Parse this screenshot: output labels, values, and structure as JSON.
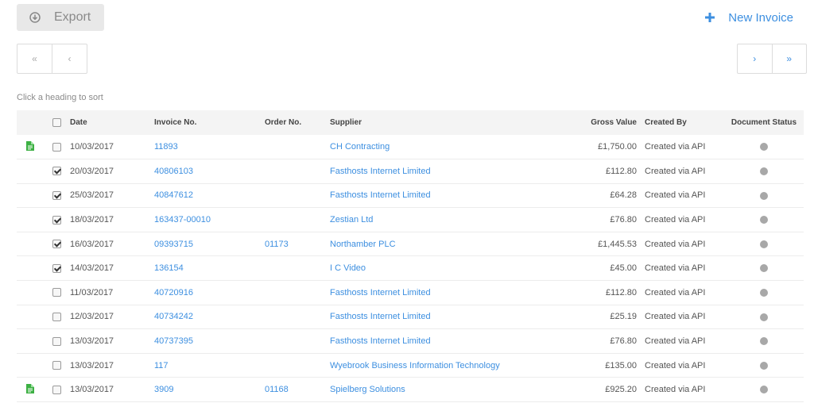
{
  "toolbar": {
    "export_label": "Export",
    "new_invoice_label": "New Invoice"
  },
  "pager": {
    "first": "«",
    "prev": "‹",
    "next": "›",
    "last": "»"
  },
  "sort_hint": "Click a heading to sort",
  "columns": {
    "date": "Date",
    "invoice_no": "Invoice No.",
    "order_no": "Order No.",
    "supplier": "Supplier",
    "gross_value": "Gross Value",
    "created_by": "Created By",
    "document_status": "Document Status"
  },
  "colors": {
    "accent": "#3d8fe0",
    "doc_icon": "#3cb043",
    "status_dot": "#a8a8a8"
  },
  "rows": [
    {
      "has_doc": true,
      "checked": false,
      "date": "10/03/2017",
      "invoice_no": "11893",
      "order_no": "",
      "supplier": "CH Contracting",
      "gross_value": "£1,750.00",
      "created_by": "Created via API"
    },
    {
      "has_doc": false,
      "checked": true,
      "date": "20/03/2017",
      "invoice_no": "40806103",
      "order_no": "",
      "supplier": "Fasthosts Internet Limited",
      "gross_value": "£112.80",
      "created_by": "Created via API"
    },
    {
      "has_doc": false,
      "checked": true,
      "date": "25/03/2017",
      "invoice_no": "40847612",
      "order_no": "",
      "supplier": "Fasthosts Internet Limited",
      "gross_value": "£64.28",
      "created_by": "Created via API"
    },
    {
      "has_doc": false,
      "checked": true,
      "date": "18/03/2017",
      "invoice_no": "163437-00010",
      "order_no": "",
      "supplier": "Zestian Ltd",
      "gross_value": "£76.80",
      "created_by": "Created via API"
    },
    {
      "has_doc": false,
      "checked": true,
      "date": "16/03/2017",
      "invoice_no": "09393715",
      "order_no": "01173",
      "supplier": "Northamber PLC",
      "gross_value": "£1,445.53",
      "created_by": "Created via API"
    },
    {
      "has_doc": false,
      "checked": true,
      "date": "14/03/2017",
      "invoice_no": "136154",
      "order_no": "",
      "supplier": "I C Video",
      "gross_value": "£45.00",
      "created_by": "Created via API"
    },
    {
      "has_doc": false,
      "checked": false,
      "date": "11/03/2017",
      "invoice_no": "40720916",
      "order_no": "",
      "supplier": "Fasthosts Internet Limited",
      "gross_value": "£112.80",
      "created_by": "Created via API"
    },
    {
      "has_doc": false,
      "checked": false,
      "date": "12/03/2017",
      "invoice_no": "40734242",
      "order_no": "",
      "supplier": "Fasthosts Internet Limited",
      "gross_value": "£25.19",
      "created_by": "Created via API"
    },
    {
      "has_doc": false,
      "checked": false,
      "date": "13/03/2017",
      "invoice_no": "40737395",
      "order_no": "",
      "supplier": "Fasthosts Internet Limited",
      "gross_value": "£76.80",
      "created_by": "Created via API"
    },
    {
      "has_doc": false,
      "checked": false,
      "date": "13/03/2017",
      "invoice_no": "117",
      "order_no": "",
      "supplier": "Wyebrook Business Information Technology",
      "gross_value": "£135.00",
      "created_by": "Created via API"
    },
    {
      "has_doc": true,
      "checked": false,
      "date": "13/03/2017",
      "invoice_no": "3909",
      "order_no": "01168",
      "supplier": "Spielberg Solutions",
      "gross_value": "£925.20",
      "created_by": "Created via API"
    }
  ]
}
